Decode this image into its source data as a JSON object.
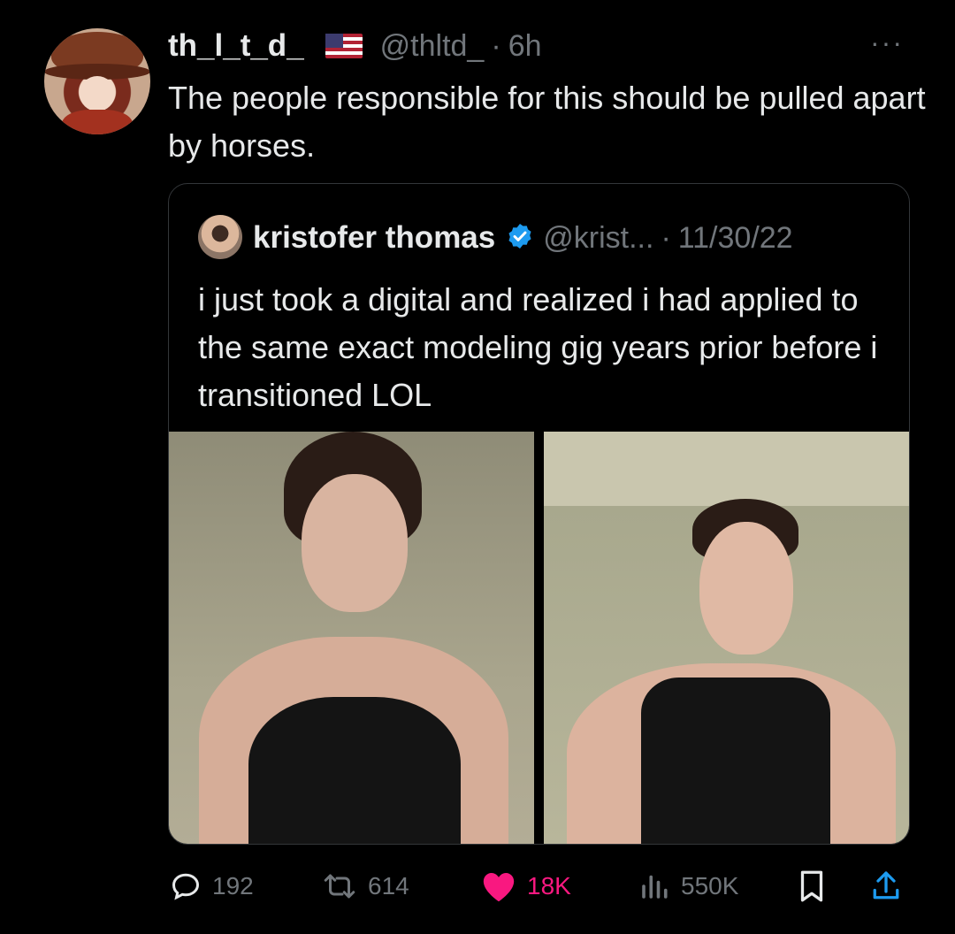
{
  "tweet": {
    "author_name": "th_l_t_d_",
    "flag": "us-flag",
    "handle": "@thltd_",
    "separator": "·",
    "time": "6h",
    "text": "The people responsible for this should be pulled apart by horses.",
    "more_icon": "···"
  },
  "quoted": {
    "author_name": "kristofer thomas",
    "verified": true,
    "handle": "@krist...",
    "separator": "·",
    "date": "11/30/22",
    "text": "i just took a digital and realized i had applied to the same exact modeling gig years prior before i transitioned LOL",
    "photos": [
      "photo-left-portrait",
      "photo-right-portrait"
    ]
  },
  "actions": {
    "reply": {
      "icon": "reply-icon",
      "count": "192"
    },
    "retweet": {
      "icon": "retweet-icon",
      "count": "614"
    },
    "like": {
      "icon": "heart-icon",
      "count": "18K",
      "active": true,
      "color": "#f91880"
    },
    "views": {
      "icon": "views-icon",
      "count": "550K"
    },
    "bookmark": {
      "icon": "bookmark-icon"
    },
    "share": {
      "icon": "share-icon"
    }
  },
  "colors": {
    "background": "#000000",
    "text": "#e7e9ea",
    "muted": "#71767b",
    "like": "#f91880",
    "verified": "#1d9bf0"
  }
}
